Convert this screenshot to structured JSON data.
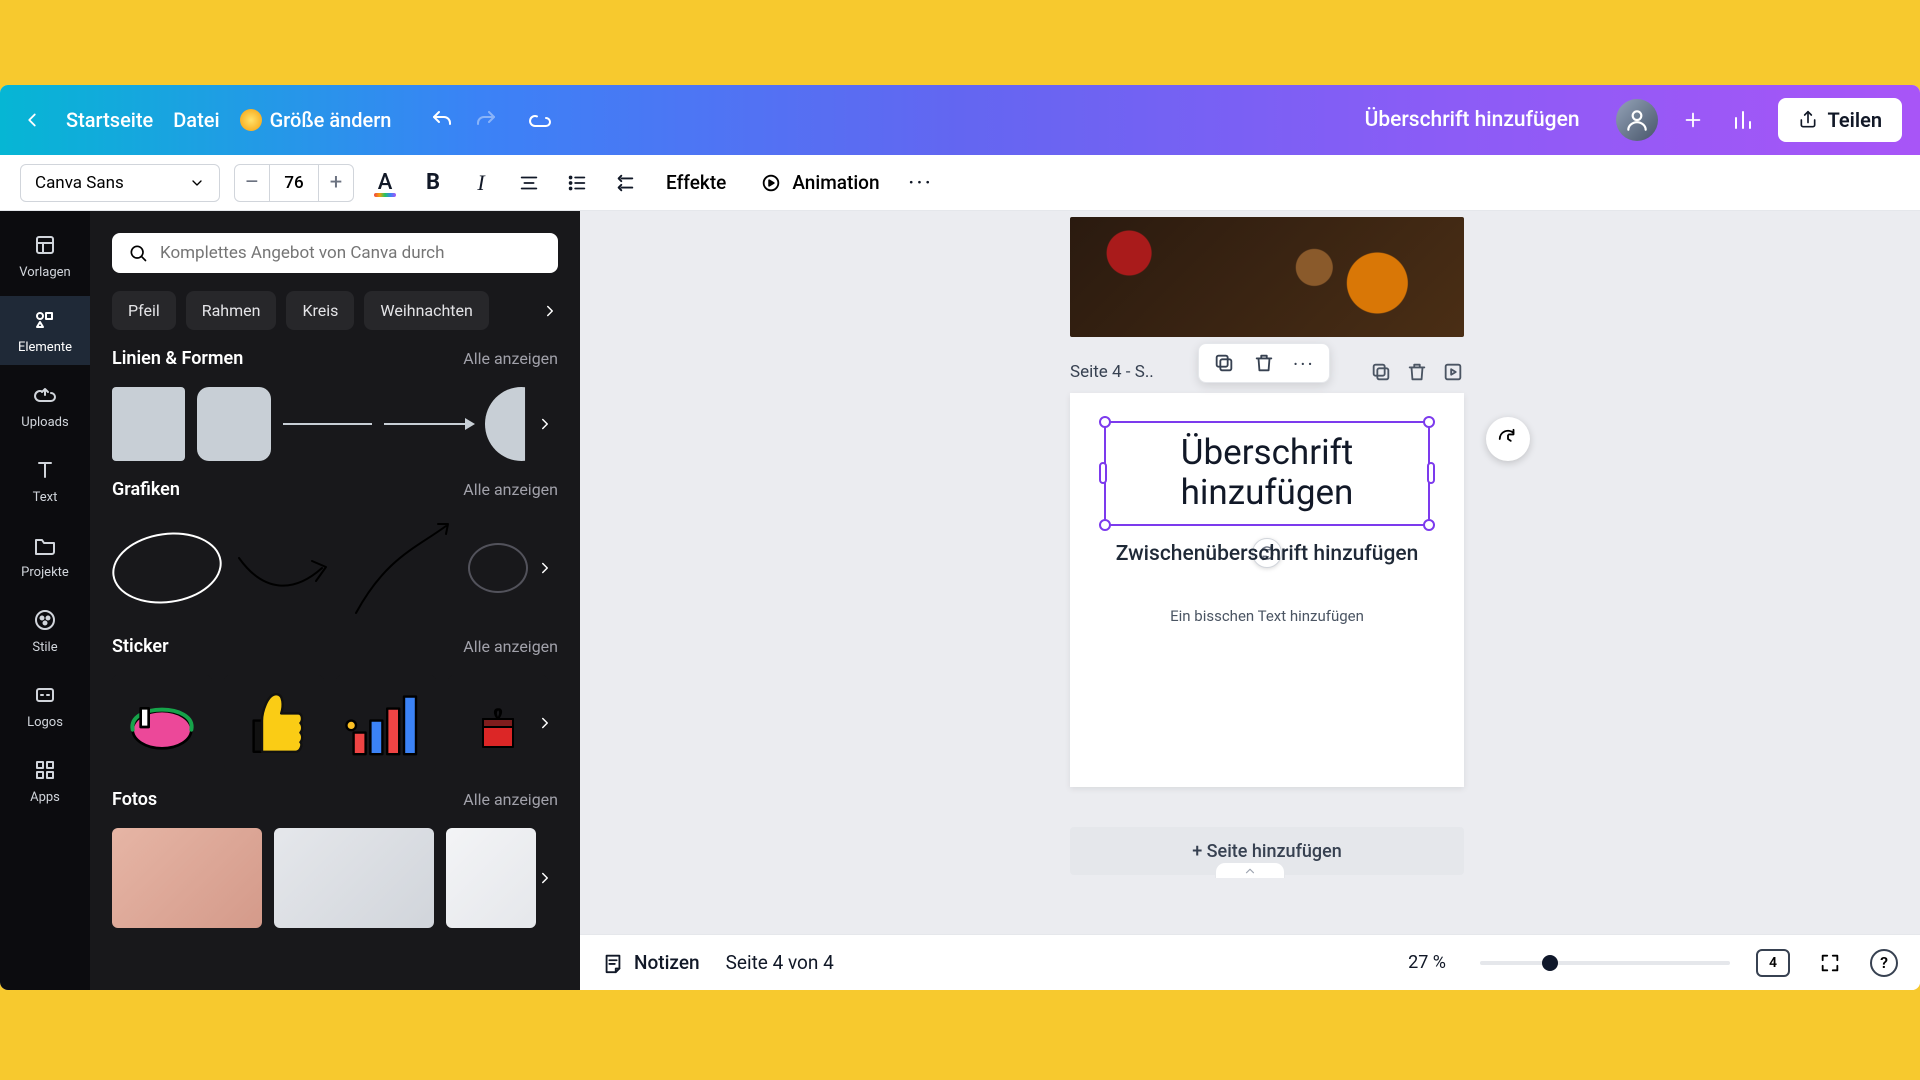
{
  "header": {
    "home": "Startseite",
    "file": "Datei",
    "resize": "Größe ändern",
    "doc_title": "Überschrift hinzufügen",
    "share": "Teilen"
  },
  "toolbar": {
    "font_family": "Canva Sans",
    "font_size": "76",
    "effects": "Effekte",
    "animation": "Animation"
  },
  "vnav": {
    "templates": "Vorlagen",
    "elements": "Elemente",
    "uploads": "Uploads",
    "text": "Text",
    "projects": "Projekte",
    "styles": "Stile",
    "logos": "Logos",
    "apps": "Apps"
  },
  "panel": {
    "search_placeholder": "Komplettes Angebot von Canva durch",
    "chips": [
      "Pfeil",
      "Rahmen",
      "Kreis",
      "Weihnachten"
    ],
    "see_all": "Alle anzeigen",
    "sec_lines": "Linien & Formen",
    "sec_graphics": "Grafiken",
    "sec_sticker": "Sticker",
    "sec_photos": "Fotos"
  },
  "canvas": {
    "page_label": "Seite 4 - S..",
    "heading_l1": "Überschrift",
    "heading_l2": "hinzufügen",
    "subheading": "Zwischenüberschrift hinzufügen",
    "body": "Ein bisschen Text hinzufügen",
    "add_page": "+ Seite hinzufügen"
  },
  "footer": {
    "notes": "Notizen",
    "page_of": "Seite 4 von 4",
    "zoom_pct": "27 %",
    "grid_badge": "4"
  }
}
